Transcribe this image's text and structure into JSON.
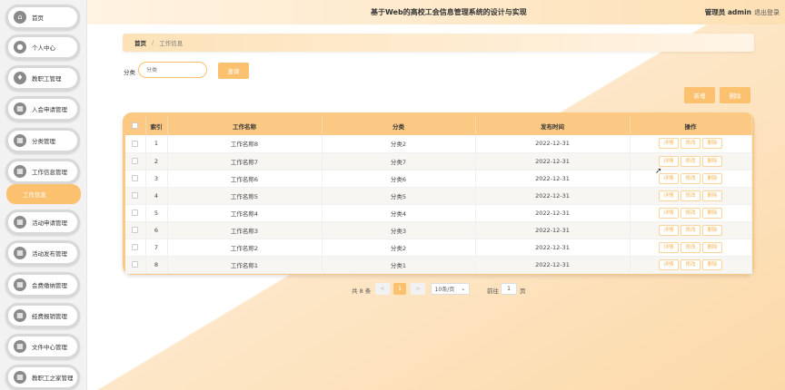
{
  "header": {
    "title": "基于Web的高校工会信息管理系统的设计与实现",
    "user": "管理员 admin",
    "logout": "退出登录"
  },
  "sidebar": {
    "items": [
      {
        "label": "首页",
        "icon": "home-icon"
      },
      {
        "label": "个人中心",
        "icon": "person-icon"
      },
      {
        "label": "教职工管理",
        "icon": "shield-icon"
      },
      {
        "label": "入会申请管理",
        "icon": "grid-icon"
      },
      {
        "label": "分类管理",
        "icon": "grid-icon"
      },
      {
        "label": "工作信息管理",
        "icon": "grid-icon"
      },
      {
        "label": "活动申请管理",
        "icon": "grid-icon"
      },
      {
        "label": "活动发布管理",
        "icon": "grid-icon"
      },
      {
        "label": "会费缴纳管理",
        "icon": "grid-icon"
      },
      {
        "label": "经费报销管理",
        "icon": "grid-icon"
      },
      {
        "label": "文件中心管理",
        "icon": "grid-icon"
      },
      {
        "label": "教职工之家管理",
        "icon": "grid-icon"
      }
    ],
    "sub_active": "工作信息"
  },
  "breadcrumb": {
    "home": "首页",
    "separator": "/",
    "current": "工作信息"
  },
  "search": {
    "label": "分类",
    "placeholder": "分类",
    "button": "查询"
  },
  "actions": {
    "add": "新增",
    "delete": "删除"
  },
  "table": {
    "headers": [
      "索引",
      "工作名称",
      "分类",
      "发布时间",
      "操作"
    ],
    "rows": [
      {
        "index": "1",
        "name": "工作名称8",
        "category": "分类2",
        "date": "2022-12-31"
      },
      {
        "index": "2",
        "name": "工作名称7",
        "category": "分类7",
        "date": "2022-12-31"
      },
      {
        "index": "3",
        "name": "工作名称6",
        "category": "分类6",
        "date": "2022-12-31"
      },
      {
        "index": "4",
        "name": "工作名称5",
        "category": "分类5",
        "date": "2022-12-31"
      },
      {
        "index": "5",
        "name": "工作名称4",
        "category": "分类4",
        "date": "2022-12-31"
      },
      {
        "index": "6",
        "name": "工作名称3",
        "category": "分类3",
        "date": "2022-12-31"
      },
      {
        "index": "7",
        "name": "工作名称2",
        "category": "分类2",
        "date": "2022-12-31"
      },
      {
        "index": "8",
        "name": "工作名称1",
        "category": "分类1",
        "date": "2022-12-31"
      }
    ],
    "ops": {
      "detail": "详情",
      "edit": "修改",
      "delete": "删除"
    }
  },
  "pagination": {
    "total": "共 8 条",
    "prev": "<",
    "current": "1",
    "next": ">",
    "page_size": "10条/页",
    "goto_label": "前往",
    "goto_value": "1",
    "page_unit": "页"
  },
  "colors": {
    "accent": "#fcc16f",
    "header_bg": "#fcc985"
  }
}
